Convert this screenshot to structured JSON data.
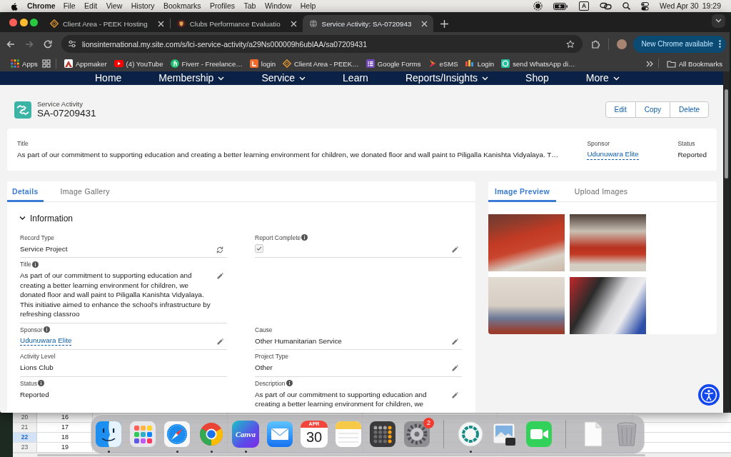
{
  "menu_bar": {
    "app": "Chrome",
    "menus": [
      "File",
      "Edit",
      "View",
      "History",
      "Bookmarks",
      "Profiles",
      "Tab",
      "Window",
      "Help"
    ],
    "input_source": "A",
    "date": "Wed Apr 30",
    "time": "19:29"
  },
  "browser": {
    "tabs": [
      {
        "title": "Client Area - PEEK Hosting",
        "kind": "diamond",
        "selected": false
      },
      {
        "title": "Clubs Performance Evaluatio",
        "kind": "crest",
        "selected": false
      },
      {
        "title": "Service Activity: SA-0720943",
        "kind": "globe",
        "selected": true
      }
    ],
    "nav_buttons": [
      {
        "kind": "back",
        "disabled": false
      },
      {
        "kind": "forward",
        "disabled": true
      },
      {
        "kind": "reload",
        "disabled": false
      }
    ],
    "url": "lionsinternational.my.site.com/s/lci-service-activity/a29Ns000009h6ublAA/sa07209431",
    "update_button": "New Chrome available",
    "bookmarks": [
      {
        "kind": "apps",
        "label": "Apps"
      },
      {
        "kind": "grid"
      },
      {
        "kind": "mountain",
        "label": "Appmaker"
      },
      {
        "kind": "play",
        "label": "(4) YouTube"
      },
      {
        "kind": "circle",
        "label": "Fiverr - Freelance…"
      },
      {
        "kind": "square",
        "label": "login"
      },
      {
        "kind": "diamond",
        "label": "Client Area - PEEK…"
      },
      {
        "kind": "form",
        "label": "Google Forms"
      },
      {
        "kind": "chevron",
        "label": "eSMS"
      },
      {
        "kind": "bars",
        "label": "Login"
      },
      {
        "kind": "ring",
        "label": "send WhatsApp di…"
      }
    ],
    "all_bookmarks": "All Bookmarks"
  },
  "site_nav": [
    {
      "label": "Home",
      "dropdown": false
    },
    {
      "label": "Membership",
      "dropdown": true
    },
    {
      "label": "Service",
      "dropdown": true
    },
    {
      "label": "Learn",
      "dropdown": false
    },
    {
      "label": "Reports/Insights",
      "dropdown": true
    },
    {
      "label": "Shop",
      "dropdown": false
    },
    {
      "label": "More",
      "dropdown": true
    }
  ],
  "record": {
    "object_type": "Service Activity",
    "name": "SA-07209431",
    "actions": [
      "Edit",
      "Copy",
      "Delete"
    ]
  },
  "highlights": [
    {
      "label": "Title",
      "value": "As part of our commitment to supporting education and creating a better learning environment for children, we donated floor and wall paint to Piligalla Kanishta Vidyalaya. T…",
      "kind": "text"
    },
    {
      "label": "Sponsor",
      "value": "Udunuwara Elite",
      "kind": "link"
    },
    {
      "label": "Status",
      "value": "Reported",
      "kind": "text"
    }
  ],
  "details": {
    "tabs": [
      {
        "label": "Details",
        "selected": true
      },
      {
        "label": "Image Gallery",
        "selected": false
      }
    ],
    "section": {
      "title": "Information",
      "expanded": true
    },
    "rows": [
      [
        {
          "label": "Record Type",
          "info": false,
          "kind": "text",
          "value": "Service Project",
          "action": {
            "kind": "swap"
          }
        },
        {
          "label": "Report Complete",
          "info": true,
          "kind": "checkbox",
          "checked": true,
          "action": {
            "kind": "edit"
          }
        }
      ],
      [
        {
          "label": "Title",
          "info": true,
          "kind": "text",
          "value": "As part of our commitment to supporting education and creating a better learning environment for children, we donated floor and wall paint to Piligalla Kanishta Vidyalaya. This initiative aimed to enhance the school’s infrastructure by refreshing classroo",
          "action": {
            "kind": "edit"
          }
        }
      ],
      [
        {
          "label": "Sponsor",
          "info": true,
          "kind": "link",
          "value": "Udunuwara Elite",
          "action": {
            "kind": "edit"
          }
        },
        {
          "label": "Cause",
          "info": false,
          "kind": "text",
          "value": "Other Humanitarian Service",
          "action": {
            "kind": "edit"
          }
        }
      ],
      [
        {
          "label": "Activity Level",
          "info": false,
          "kind": "text",
          "value": "Lions Club"
        },
        {
          "label": "Project Type",
          "info": false,
          "kind": "text",
          "value": "Other",
          "action": {
            "kind": "edit"
          }
        }
      ],
      [
        {
          "label": "Status",
          "info": true,
          "kind": "text",
          "value": "Reported"
        },
        {
          "label": "Description",
          "info": true,
          "kind": "text",
          "value": "As part of our commitment to supporting education and creating a better learning environment for children, we",
          "action": {
            "kind": "edit"
          }
        }
      ]
    ]
  },
  "gallery": {
    "tabs": [
      {
        "label": "Image Preview",
        "selected": true
      },
      {
        "label": "Upload Images",
        "selected": false
      }
    ]
  },
  "sheet": {
    "rows": [
      {
        "number": "20",
        "value": "16",
        "selected": false
      },
      {
        "number": "21",
        "value": "17",
        "selected": false
      },
      {
        "number": "22",
        "value": "18",
        "selected": true
      },
      {
        "number": "23",
        "value": "19",
        "selected": false
      }
    ]
  },
  "dock": {
    "items": [
      {
        "kind": "face",
        "running": true
      },
      {
        "kind": "launcher",
        "running": false
      },
      {
        "kind": "compass",
        "running": true
      },
      {
        "kind": "browser",
        "running": true
      },
      {
        "kind": "wordmark",
        "label": "Canva",
        "running": true
      },
      {
        "kind": "envelope",
        "running": false
      },
      {
        "kind": "calendar",
        "month": "APR",
        "day": "30",
        "running": false
      },
      {
        "kind": "notepad",
        "running": false
      },
      {
        "kind": "calculator",
        "running": false
      },
      {
        "kind": "gear",
        "badge": "2",
        "running": false
      },
      {
        "kind": "separator"
      },
      {
        "kind": "ring",
        "running": true
      },
      {
        "kind": "viewer",
        "running": false
      },
      {
        "kind": "camera",
        "running": false
      },
      {
        "kind": "separator"
      },
      {
        "kind": "document",
        "running": false
      },
      {
        "kind": "trash",
        "running": false
      }
    ]
  }
}
